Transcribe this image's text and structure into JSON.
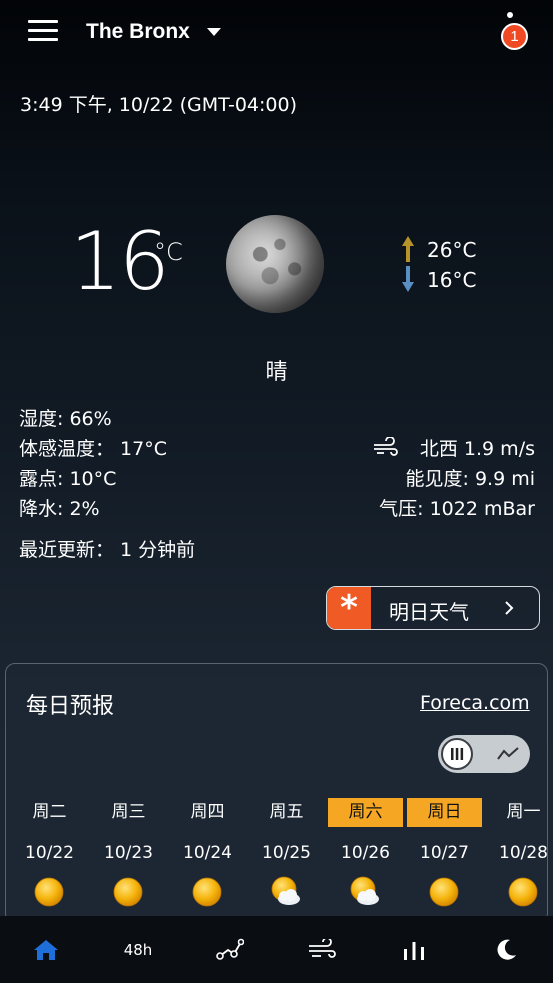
{
  "header": {
    "city": "The Bronx",
    "notification_count": "1"
  },
  "datetime": "3:49 下午, 10/22 (GMT-04:00)",
  "current": {
    "temperature": "16",
    "unit": "°C",
    "high": "26°C",
    "low": "16°C",
    "condition": "晴",
    "humidity": "湿度: 66%",
    "feels_like": "体感温度：  17°C",
    "dew_point": "露点: 10°C",
    "precipitation": "降水: 2%",
    "wind": "北西 1.9 m/s",
    "visibility": "能见度: 9.9 mi",
    "pressure": "气压: 1022 mBar",
    "last_update": "最近更新：  1 分钟前"
  },
  "tomorrow_button": {
    "label": "明日天气"
  },
  "daily": {
    "title": "每日预报",
    "source_link": "Foreca.com",
    "days": [
      {
        "day": "周二",
        "date": "10/22",
        "weekend": false,
        "icon": "sun-icon"
      },
      {
        "day": "周三",
        "date": "10/23",
        "weekend": false,
        "icon": "sun-icon"
      },
      {
        "day": "周四",
        "date": "10/24",
        "weekend": false,
        "icon": "sun-icon"
      },
      {
        "day": "周五",
        "date": "10/25",
        "weekend": false,
        "icon": "partly-cloudy-icon"
      },
      {
        "day": "周六",
        "date": "10/26",
        "weekend": true,
        "icon": "partly-cloudy-icon"
      },
      {
        "day": "周日",
        "date": "10/27",
        "weekend": true,
        "icon": "sun-icon"
      },
      {
        "day": "周一",
        "date": "10/28",
        "weekend": false,
        "icon": "sun-icon"
      }
    ]
  },
  "bottom_nav": {
    "items": [
      "home-icon",
      "48h",
      "graph-icon",
      "wind-icon",
      "bar-chart-icon",
      "moon-icon"
    ],
    "label_48h": "48h",
    "active_color": "#1e6fd9"
  },
  "colors": {
    "accent_orange": "#f05a24",
    "weekend_highlight": "#f5a623",
    "badge_red": "#f04a25",
    "high_arrow": "#b8922a",
    "low_arrow": "#5a8fc4"
  }
}
